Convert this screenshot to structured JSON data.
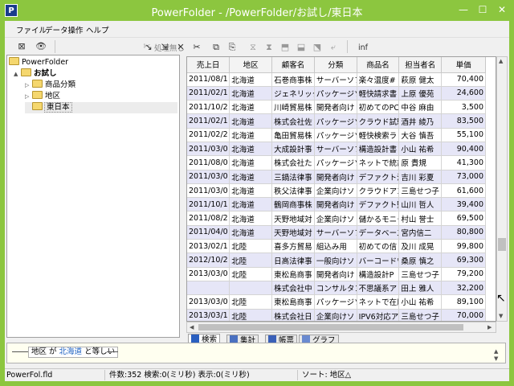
{
  "window": {
    "title": "PowerFolder - /PowerFolder/お試し/東日本",
    "app_icon": "P"
  },
  "menu": [
    "ファイル",
    "データ操作",
    "ヘルプ"
  ],
  "toolbar": {
    "status_label": "処理無し",
    "info_label": "inf"
  },
  "tree": [
    {
      "label": "PowerFolder",
      "depth": 0,
      "toggle": ""
    },
    {
      "label": "お試し",
      "depth": 1,
      "toggle": "▲"
    },
    {
      "label": "商品分類",
      "depth": 2,
      "toggle": "▷"
    },
    {
      "label": "地区",
      "depth": 2,
      "toggle": "▷"
    },
    {
      "label": "東日本",
      "depth": 2,
      "toggle": "",
      "selected": true
    }
  ],
  "grid": {
    "columns": [
      "売上日",
      "地区",
      "顧客名",
      "分類",
      "商品名",
      "担当者名",
      "単価"
    ],
    "rows": [
      [
        "2011/08/1",
        "北海道",
        "石巻商事株",
        "サーバーソフ",
        "楽々温度#",
        "萩原 健太",
        "70,400"
      ],
      [
        "2011/02/1",
        "北海道",
        "ジェネリック",
        "パッケージソ",
        "軽快請求書",
        "上原 優苑",
        "24,600"
      ],
      [
        "2011/10/2",
        "北海道",
        "川崎貿易株",
        "開発者向け",
        "初めてのPC",
        "中谷 麻由",
        "3,500"
      ],
      [
        "2011/02/1",
        "北海道",
        "株式会社佐",
        "パッケージソ",
        "クラウド試験",
        "酒井 綾乃",
        "83,500"
      ],
      [
        "2011/02/2",
        "北海道",
        "亀田貿易株",
        "パッケージソ",
        "軽快検索ラ",
        "大谷 慎吾",
        "55,100"
      ],
      [
        "2011/03/0",
        "北海道",
        "大成設計事",
        "サーバーソフ",
        "構造設計書",
        "小山 祐希",
        "90,400"
      ],
      [
        "2011/08/0",
        "北海道",
        "株式会社た",
        "パッケージソ",
        "ネットで統計",
        "原 貴規",
        "41,300"
      ],
      [
        "2011/03/0",
        "北海道",
        "三鍋法律事",
        "開発者向け",
        "デファクト温",
        "吉川 彩夏",
        "73,000"
      ],
      [
        "2011/03/0",
        "北海道",
        "秩父法律事",
        "企業向けソ",
        "クラウドアン",
        "三島せつ子",
        "61,600"
      ],
      [
        "2011/10/1",
        "北海道",
        "鶴岡商事株",
        "開発者向け",
        "デファクト監",
        "山川 哲人",
        "39,400"
      ],
      [
        "2011/08/2",
        "北海道",
        "天野地域対",
        "企業向けソ",
        "儲かるモニタ",
        "村山 誉士",
        "69,500"
      ],
      [
        "2011/04/0",
        "北海道",
        "天野地域対",
        "サーバーソフ",
        "データベース",
        "宮内信二",
        "80,800"
      ],
      [
        "2013/02/1",
        "北陸",
        "喜多方貿易",
        "組込み用",
        "初めての信",
        "及川 成晃",
        "99,800"
      ],
      [
        "2012/10/2",
        "北陸",
        "日高法律事",
        "一般向けソ",
        "バーコードワ",
        "桑原 慎之",
        "69,300"
      ],
      [
        "2013/03/0",
        "北陸",
        "東松島商事",
        "開発者向け",
        "構造設計P",
        "三島せつ子",
        "79,200"
      ],
      [
        "",
        "",
        "株式会社中",
        "コンサルタン",
        "不思議系ア",
        "田上 雅人",
        "32,200"
      ],
      [
        "2013/03/0",
        "北陸",
        "東松島商事",
        "パッケージソ",
        "ネットで在庫",
        "小山 祐希",
        "89,100"
      ],
      [
        "2013/03/1",
        "北陸",
        "株式会社日",
        "企業向けソ",
        "IPV6対応ア",
        "三島せつ子",
        "70,000"
      ]
    ]
  },
  "tabs": [
    "検索",
    "集計",
    "帳票",
    "グラフ"
  ],
  "filter": {
    "prefix": "地区 が ",
    "value": "北海道",
    "suffix": " と等しい"
  },
  "status": {
    "file": "PowerFol.fld",
    "counts": "件数:352  検索:0(ミリ秒)  表示:0(ミリ秒)",
    "sort": "ソート: 地区△"
  }
}
